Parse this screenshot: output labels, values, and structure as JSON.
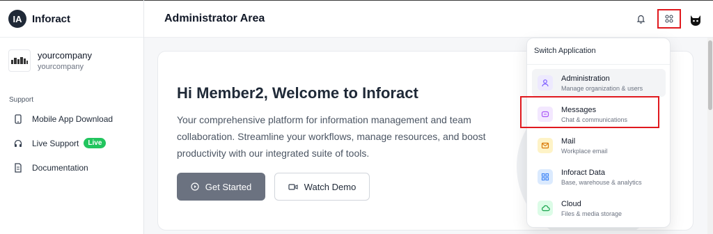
{
  "brand": {
    "name": "Inforact",
    "logo_text": "IA"
  },
  "company": {
    "name": "yourcompany",
    "sub": "yourcompany"
  },
  "sidebar": {
    "section": "Support",
    "items": [
      {
        "label": "Mobile App Download",
        "icon": "mobile-icon"
      },
      {
        "label": "Live Support",
        "icon": "headset-icon",
        "badge": "Live"
      },
      {
        "label": "Documentation",
        "icon": "document-icon"
      }
    ]
  },
  "header": {
    "title": "Administrator Area",
    "icons": [
      "bell-icon",
      "apps-grid-icon",
      "cat-avatar"
    ]
  },
  "hero": {
    "title": "Hi Member2, Welcome to Inforact",
    "description": "Your comprehensive platform for information management and team collaboration. Streamline your workflows, manage resources, and boost productivity with our integrated suite of tools.",
    "primary_button": "Get Started",
    "secondary_button": "Watch Demo"
  },
  "switcher": {
    "title": "Switch Application",
    "apps": [
      {
        "name": "Administration",
        "desc": "Manage organization & users",
        "icon": "user-icon",
        "color": "#7c5cff",
        "bg": "#ede9fe"
      },
      {
        "name": "Messages",
        "desc": "Chat & communications",
        "icon": "chat-icon",
        "color": "#a855f7",
        "bg": "#f3e8ff"
      },
      {
        "name": "Mail",
        "desc": "Workplace email",
        "icon": "mail-icon",
        "color": "#d97706",
        "bg": "#fef3c7"
      },
      {
        "name": "Inforact Data",
        "desc": "Base, warehouse & analytics",
        "icon": "grid-data-icon",
        "color": "#3b82f6",
        "bg": "#dbeafe"
      },
      {
        "name": "Cloud",
        "desc": "Files & media storage",
        "icon": "cloud-icon",
        "color": "#16a34a",
        "bg": "#dcfce7"
      }
    ]
  },
  "colors": {
    "highlight": "#e0191e",
    "live_badge": "#22c55e",
    "primary_button": "#6b7280"
  }
}
